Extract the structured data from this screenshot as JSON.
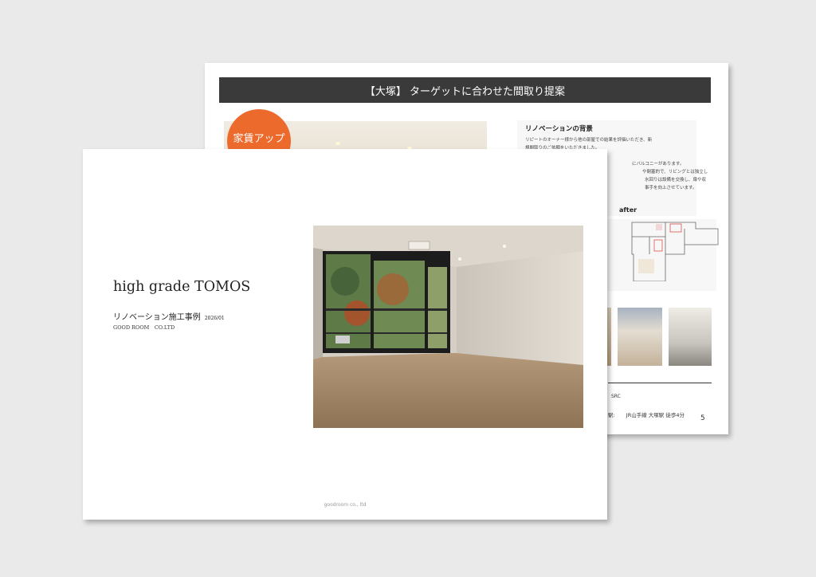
{
  "back_page": {
    "header": "【大塚】 ターゲットに合わせた間取り提案",
    "badge": "家賃アップ",
    "renovation": {
      "heading": "リノベーションの背景",
      "lines": [
        "リピートのオーナー様から他の部屋での結果を評価いただき、新",
        "規間取りのご依頼をいただきました。",
        "にバルコニーがあります。",
        "や閉塞的で、リビングとは独立し",
        "水回りは設備を交換し、扉や収",
        "事手を向上させています。"
      ]
    },
    "after_label": "after",
    "structure": "SRC",
    "station_prefix": "駅:",
    "station": "JR山手線 大塚駅 徒歩4分",
    "page_number": "5"
  },
  "front_page": {
    "title": "high grade TOMOS",
    "subtitle": "リノベーション施工事例",
    "date": "2026/01",
    "company": "GOOD ROOM　CO.LTD",
    "footer": "goodroom co., ltd"
  },
  "colors": {
    "background": "#eaeaea",
    "header_bar": "#3a3a3a",
    "badge": "#ec6a2c"
  }
}
